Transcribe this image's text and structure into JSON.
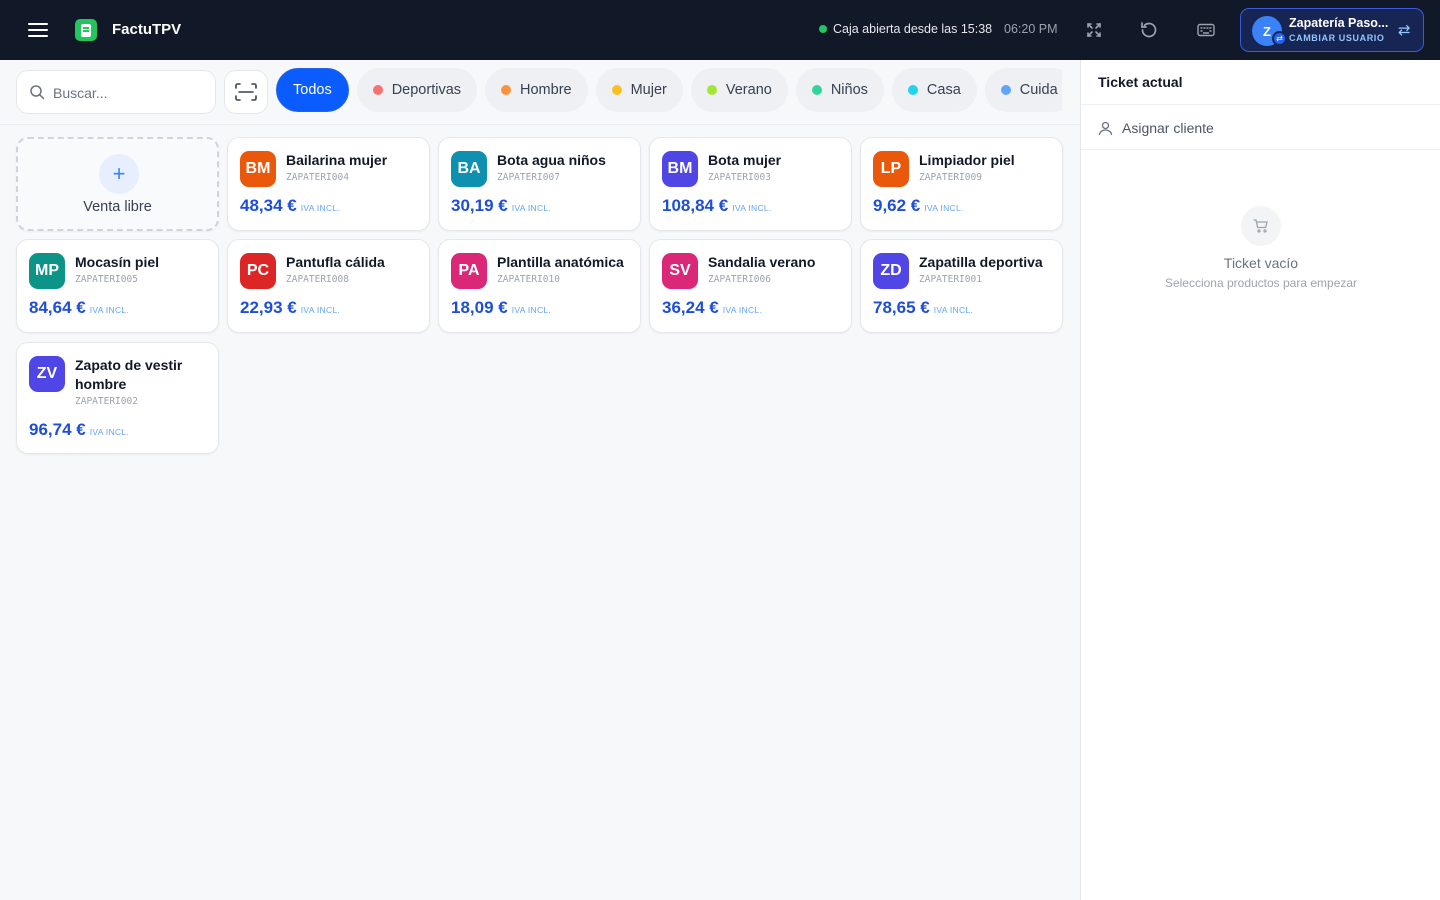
{
  "header": {
    "app_title": "FactuTPV",
    "status_text": "Caja abierta desde las 15:38",
    "time": "06:20 PM",
    "user": {
      "initial": "Z",
      "name": "Zapatería Paso...",
      "switch_label": "CAMBIAR USUARIO"
    }
  },
  "search": {
    "placeholder": "Buscar..."
  },
  "categories": [
    {
      "label": "Todos",
      "color": null,
      "active": true
    },
    {
      "label": "Deportivas",
      "color": "#f87171"
    },
    {
      "label": "Hombre",
      "color": "#fb923c"
    },
    {
      "label": "Mujer",
      "color": "#fbbf24"
    },
    {
      "label": "Verano",
      "color": "#a3e635"
    },
    {
      "label": "Niños",
      "color": "#34d399"
    },
    {
      "label": "Casa",
      "color": "#22d3ee"
    },
    {
      "label": "Cuida",
      "color": "#60a5fa"
    }
  ],
  "free_sale": {
    "label": "Venta libre"
  },
  "products": [
    {
      "initials": "BM",
      "name": "Bailarina mujer",
      "sku": "ZAPATERI004",
      "price": "48,34 €",
      "tax": "IVA INCL.",
      "color": "#ea580c"
    },
    {
      "initials": "BA",
      "name": "Bota agua niños",
      "sku": "ZAPATERI007",
      "price": "30,19 €",
      "tax": "IVA INCL.",
      "color": "#0e90b0"
    },
    {
      "initials": "BM",
      "name": "Bota mujer",
      "sku": "ZAPATERI003",
      "price": "108,84 €",
      "tax": "IVA INCL.",
      "color": "#4f46e5"
    },
    {
      "initials": "LP",
      "name": "Limpiador piel",
      "sku": "ZAPATERI009",
      "price": "9,62 €",
      "tax": "IVA INCL.",
      "color": "#ea580c"
    },
    {
      "initials": "MP",
      "name": "Mocasín piel",
      "sku": "ZAPATERI005",
      "price": "84,64 €",
      "tax": "IVA INCL.",
      "color": "#0d9488"
    },
    {
      "initials": "PC",
      "name": "Pantufla cálida",
      "sku": "ZAPATERI008",
      "price": "22,93 €",
      "tax": "IVA INCL.",
      "color": "#dc2626"
    },
    {
      "initials": "PA",
      "name": "Plantilla anatómica",
      "sku": "ZAPATERI010",
      "price": "18,09 €",
      "tax": "IVA INCL.",
      "color": "#db2777"
    },
    {
      "initials": "SV",
      "name": "Sandalia verano",
      "sku": "ZAPATERI006",
      "price": "36,24 €",
      "tax": "IVA INCL.",
      "color": "#db2777"
    },
    {
      "initials": "ZD",
      "name": "Zapatilla deportiva",
      "sku": "ZAPATERI001",
      "price": "78,65 €",
      "tax": "IVA INCL.",
      "color": "#4f46e5"
    },
    {
      "initials": "ZV",
      "name": "Zapato de vestir hombre",
      "sku": "ZAPATERI002",
      "price": "96,74 €",
      "tax": "IVA INCL.",
      "color": "#4f46e5"
    }
  ],
  "ticket": {
    "title": "Ticket actual",
    "assign_customer": "Asignar cliente",
    "empty_title": "Ticket vacío",
    "empty_subtitle": "Selecciona productos para empezar"
  },
  "icons": {
    "menu": "menu-icon",
    "fullscreen": "fullscreen-icon",
    "refresh": "refresh-icon",
    "keyboard": "keyboard-icon",
    "swap": "swap-icon",
    "search": "search-icon",
    "scan": "barcode-scan-icon",
    "user": "user-icon",
    "cart": "cart-icon"
  }
}
